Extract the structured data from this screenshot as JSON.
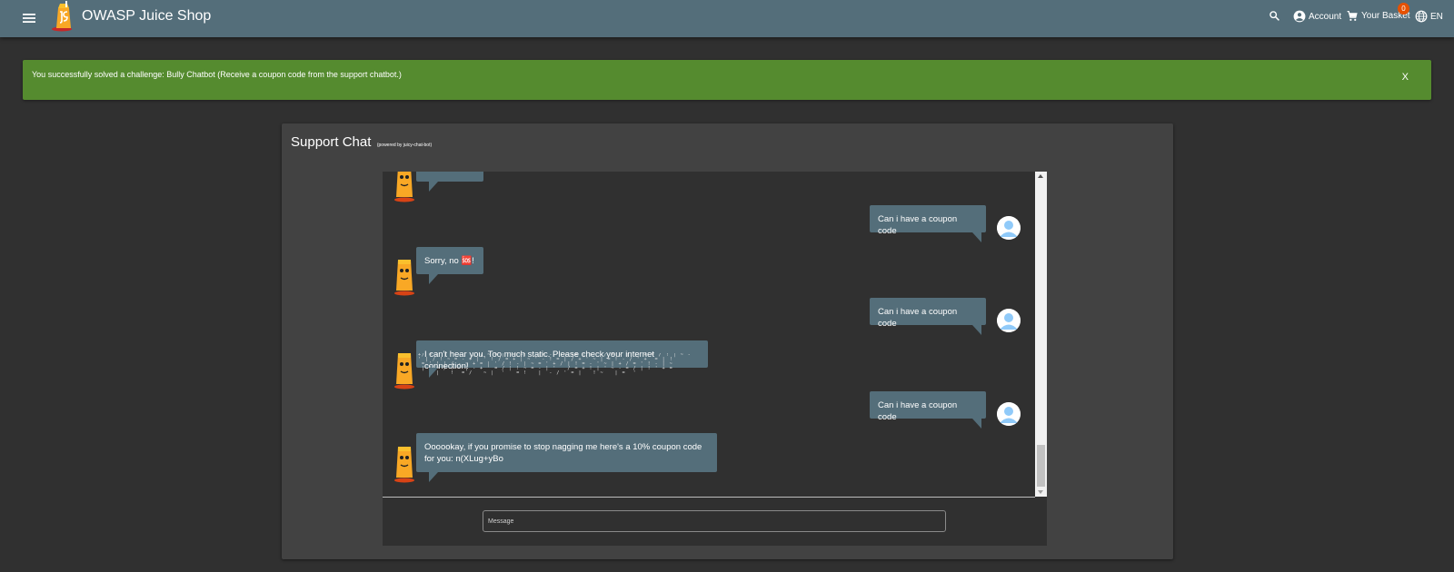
{
  "header": {
    "app_title": "OWASP Juice Shop",
    "account_label": "Account",
    "basket_label": "Your Basket",
    "basket_count": "0",
    "language_label": "EN",
    "colors": {
      "toolbar": "#546e7a",
      "badge": "#e65100"
    }
  },
  "banner": {
    "text": "You successfully solved a challenge: Bully Chatbot (Receive a coupon code from the support chatbot.)",
    "close_label": "X",
    "color": "#558b2f"
  },
  "chat": {
    "title": "Support Chat",
    "subtitle": "(powered by juicy-chat-bot)",
    "messages": [
      {
        "from": "bot",
        "text": ""
      },
      {
        "from": "user",
        "text": "Can i have a coupon code"
      },
      {
        "from": "bot",
        "text": "Sorry, no 🆘!"
      },
      {
        "from": "user",
        "text": "Can i have a coupon code"
      },
      {
        "from": "bot",
        "text": "I can't hear you. Too much static. Please check your internet connection!"
      },
      {
        "from": "user",
        "text": "Can i have a coupon code"
      },
      {
        "from": "bot",
        "text": "Oooookay, if you promise to stop nagging me here's a 10% coupon code for you: n(XLug+yBo"
      }
    ],
    "input_placeholder": "Message"
  },
  "icons": {
    "menu": "menu-icon",
    "search": "search-icon",
    "account": "account-circle-icon",
    "basket": "shopping-cart-icon",
    "language": "globe-icon",
    "bot": "juice-bot-avatar",
    "user": "user-avatar-icon"
  }
}
